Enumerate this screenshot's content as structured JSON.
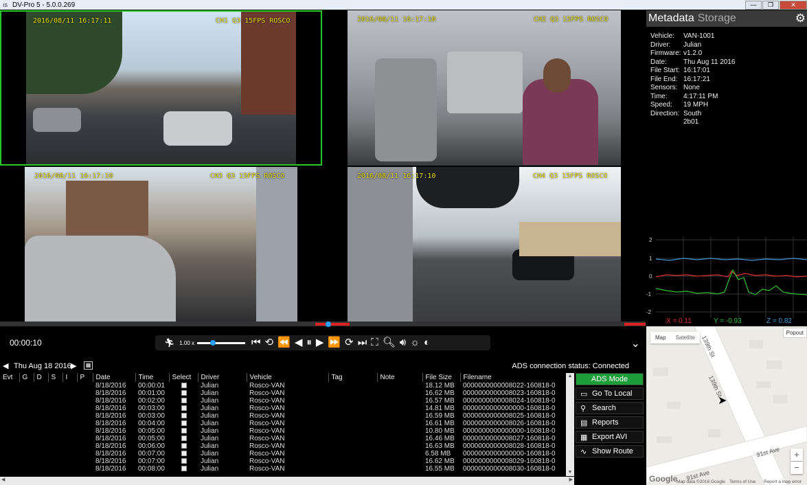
{
  "window": {
    "title": "DV-Pro 5 - 5.0.0.269",
    "icon": "app-icon"
  },
  "cameras": [
    {
      "timestamp": "2016/08/11 16:17:11",
      "label": "CH1 Q3 15FPS ROSCO"
    },
    {
      "timestamp": "2016/08/11 16:17:10",
      "label": "CH2 Q3 15FPS ROSCO"
    },
    {
      "timestamp": "2016/08/11 16:17:10",
      "label": "CH3 Q3 15FPS ROSCO"
    },
    {
      "timestamp": "2016/08/11 16:17:10",
      "label": "CH4 Q3 15FPS ROSCO"
    }
  ],
  "player": {
    "elapsed": "00:00:10",
    "speed": "1.00 x",
    "speed_fraction": 0.3
  },
  "datebar": {
    "date": "Thu Aug 18 2016",
    "status": "ADS connection status: Connected"
  },
  "table": {
    "columns": [
      "Evt",
      "G",
      "D",
      "S",
      "I",
      "P",
      "Date",
      "Time",
      "Select",
      "Driver",
      "Vehicle",
      "Tag",
      "Note",
      "File Size",
      "Filename"
    ],
    "rows": [
      {
        "date": "8/18/2016",
        "time": "00:00:01",
        "driver": "Julian",
        "vehicle": "Rosco-VAN",
        "size": "18.12 MB",
        "file": "0000000000008022-160818-0"
      },
      {
        "date": "8/18/2016",
        "time": "00:01:00",
        "driver": "Julian",
        "vehicle": "Rosco-VAN",
        "size": "16.62 MB",
        "file": "0000000000008023-160818-0"
      },
      {
        "date": "8/18/2016",
        "time": "00:02:00",
        "driver": "Julian",
        "vehicle": "Rosco-VAN",
        "size": "16.57 MB",
        "file": "0000000000008024-160818-0"
      },
      {
        "date": "8/18/2016",
        "time": "00:03:00",
        "driver": "Julian",
        "vehicle": "Rosco-VAN",
        "size": "14.81 MB",
        "file": "0000000000000000-160818-0"
      },
      {
        "date": "8/18/2016",
        "time": "00:03:00",
        "driver": "Julian",
        "vehicle": "Rosco-VAN",
        "size": "16.59 MB",
        "file": "0000000000008025-160818-0"
      },
      {
        "date": "8/18/2016",
        "time": "00:04:00",
        "driver": "Julian",
        "vehicle": "Rosco-VAN",
        "size": "16.61 MB",
        "file": "0000000000008026-160818-0"
      },
      {
        "date": "8/18/2016",
        "time": "00:05:00",
        "driver": "Julian",
        "vehicle": "Rosco-VAN",
        "size": "10.80 MB",
        "file": "0000000000000000-160818-0"
      },
      {
        "date": "8/18/2016",
        "time": "00:05:00",
        "driver": "Julian",
        "vehicle": "Rosco-VAN",
        "size": "16.46 MB",
        "file": "0000000000008027-160818-0"
      },
      {
        "date": "8/18/2016",
        "time": "00:06:00",
        "driver": "Julian",
        "vehicle": "Rosco-VAN",
        "size": "16.63 MB",
        "file": "0000000000008028-160818-0"
      },
      {
        "date": "8/18/2016",
        "time": "00:07:00",
        "driver": "Julian",
        "vehicle": "Rosco-VAN",
        "size": "6.58 MB",
        "file": "0000000000000000-160818-0"
      },
      {
        "date": "8/18/2016",
        "time": "00:07:00",
        "driver": "Julian",
        "vehicle": "Rosco-VAN",
        "size": "16.62 MB",
        "file": "0000000000008029-160818-0"
      },
      {
        "date": "8/18/2016",
        "time": "00:08:00",
        "driver": "Julian",
        "vehicle": "Rosco-VAN",
        "size": "16.55 MB",
        "file": "0000000000008030-160818-0"
      }
    ]
  },
  "actions": {
    "ads_mode": "ADS Mode",
    "go_local": "Go To Local",
    "search": "Search",
    "reports": "Reports",
    "export": "Export AVI",
    "route": "Show Route"
  },
  "side": {
    "tab_metadata": "Metadata",
    "tab_storage": "Storage",
    "metadata": [
      {
        "k": "Vehicle:",
        "v": "VAN-1001"
      },
      {
        "k": "Driver:",
        "v": "Julian"
      },
      {
        "k": "Firmware:",
        "v": "v1.2.0"
      },
      {
        "k": "Date:",
        "v": "Thu Aug 11 2016"
      },
      {
        "k": "File Start:",
        "v": "16:17:01"
      },
      {
        "k": "File End:",
        "v": "16:17:21"
      },
      {
        "k": "Sensors:",
        "v": "None"
      },
      {
        "k": "Time:",
        "v": "4:17:11 PM"
      },
      {
        "k": "Speed:",
        "v": "19 MPH"
      },
      {
        "k": "Direction:",
        "v": "South"
      },
      {
        "k": "",
        "v": "2b01"
      }
    ],
    "accel": {
      "y_ticks": [
        "2",
        "1",
        "0",
        "-1",
        "-2"
      ],
      "x_label": "X = 0.11",
      "y_label": "Y = -0.93",
      "z_label": "Z = 0.82",
      "colors": {
        "x": "#e03030",
        "y": "#30c030",
        "z": "#3a9ad9"
      }
    }
  },
  "map": {
    "tab_map": "Map",
    "tab_satellite": "Satellite",
    "popout": "Popout",
    "streets": [
      "139th St",
      "139th St",
      "91st Ave",
      "91st Ave"
    ],
    "zoom_in": "+",
    "zoom_out": "−",
    "google": "Google",
    "footer_data": "Map data ©2016 Google",
    "footer_terms": "Terms of Use",
    "footer_report": "Report a map error"
  }
}
